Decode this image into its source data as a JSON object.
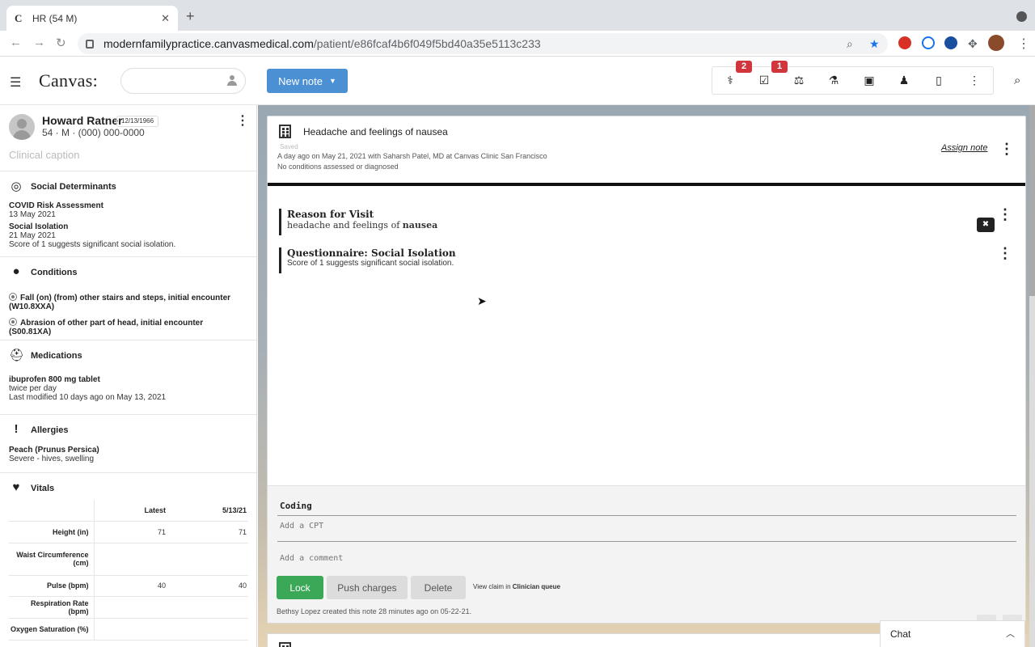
{
  "browser": {
    "tab_title": "HR (54 M)",
    "tab_favicon": "C",
    "url_host": "modernfamilypractice.canvasmedical.com",
    "url_path": "/patient/e86fcaf4b6f049f5bd40a35e5113c233"
  },
  "header": {
    "logo": "Canvas:",
    "new_note_label": "New note",
    "badge_a": "2",
    "badge_b": "1"
  },
  "patient": {
    "name": "Howard Ratner",
    "dob": "12/13/1966",
    "info": "54 · M · (000) 000-0000",
    "caption": "Clinical caption"
  },
  "sections": {
    "social": {
      "title": "Social Determinants",
      "items": [
        {
          "name": "COVID Risk Assessment",
          "date": "13 May 2021",
          "note": ""
        },
        {
          "name": "Social Isolation",
          "date": "21 May 2021",
          "note": "Score of 1 suggests significant social isolation."
        }
      ]
    },
    "conditions": {
      "title": "Conditions",
      "items": [
        "Fall (on) (from) other stairs and steps, initial encounter (W10.8XXA)",
        "Abrasion of other part of head, initial encounter (S00.81XA)"
      ]
    },
    "medications": {
      "title": "Medications",
      "name": "ibuprofen 800 mg tablet",
      "freq": "twice per day",
      "modified": "Last modified 10 days ago on May 13, 2021"
    },
    "allergies": {
      "title": "Allergies",
      "name": "Peach (Prunus Persica)",
      "severity": "Severe - hives, swelling"
    },
    "vitals": {
      "title": "Vitals",
      "col_latest": "Latest",
      "col_date": "5/13/21",
      "rows": [
        {
          "label": "Height (in)",
          "latest": "71",
          "date": "71"
        },
        {
          "label": "Waist Circumference (cm)",
          "latest": "",
          "date": ""
        },
        {
          "label": "Pulse (bpm)",
          "latest": "40",
          "date": "40"
        },
        {
          "label": "Respiration Rate (bpm)",
          "latest": "",
          "date": ""
        },
        {
          "label": "Oxygen Saturation (%)",
          "latest": "",
          "date": ""
        }
      ]
    }
  },
  "note": {
    "title": "Headache and feelings of nausea",
    "saved": "Saved",
    "meta1": "A day ago on May 21, 2021 with Saharsh Patel, MD at Canvas Clinic San Francisco",
    "meta2": "No conditions assessed or diagnosed",
    "assign": "Assign note",
    "reason_title": "Reason for Visit",
    "reason_body_pre": "headache and feelings of",
    "reason_body_bold": "nausea",
    "delete_icon": "✖",
    "q_title": "Questionnaire: Social Isolation",
    "q_body": "Score of 1 suggests significant social isolation.",
    "coding_title": "Coding",
    "cpt_placeholder": "Add a CPT",
    "comment_placeholder": "Add a comment",
    "lock_label": "Lock",
    "push_label": "Push charges",
    "delete_label": "Delete",
    "view_claim_pre": "View claim in",
    "view_claim_link": "Clinician queue",
    "created": "Bethsy Lopez created this note 28 minutes ago on 05-22-21."
  },
  "chat": {
    "label": "Chat"
  }
}
